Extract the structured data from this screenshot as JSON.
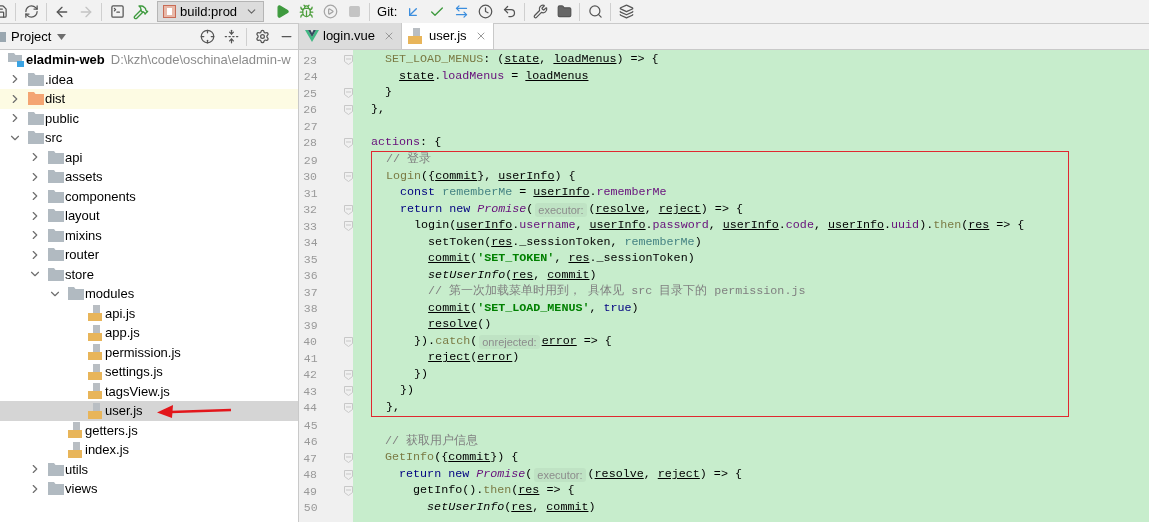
{
  "toolbar": {
    "run_configuration": "build:prod",
    "vcs_label": "Git:"
  },
  "project_panel": {
    "title": "Project",
    "tree": {
      "name": "eladmin-web",
      "path": "D:\\kzh\\code\\oschina\\eladmin-w",
      "kind": "project",
      "selected": false,
      "children": [
        {
          "name": ".idea",
          "kind": "folder",
          "expanded": false,
          "selected": false
        },
        {
          "name": "dist",
          "kind": "excluded_folder",
          "expanded": false,
          "selected": false
        },
        {
          "name": "public",
          "kind": "folder",
          "expanded": false,
          "selected": false
        },
        {
          "name": "src",
          "kind": "folder",
          "expanded": true,
          "selected": false,
          "children": [
            {
              "name": "api",
              "kind": "folder",
              "expanded": false,
              "selected": false
            },
            {
              "name": "assets",
              "kind": "folder",
              "expanded": false,
              "selected": false
            },
            {
              "name": "components",
              "kind": "folder",
              "expanded": false,
              "selected": false
            },
            {
              "name": "layout",
              "kind": "folder",
              "expanded": false,
              "selected": false
            },
            {
              "name": "mixins",
              "kind": "folder",
              "expanded": false,
              "selected": false
            },
            {
              "name": "router",
              "kind": "folder",
              "expanded": false,
              "selected": false
            },
            {
              "name": "store",
              "kind": "folder",
              "expanded": true,
              "selected": false,
              "children": [
                {
                  "name": "modules",
                  "kind": "folder",
                  "expanded": true,
                  "selected": false,
                  "children": [
                    {
                      "name": "api.js",
                      "kind": "file",
                      "selected": false
                    },
                    {
                      "name": "app.js",
                      "kind": "file",
                      "selected": false
                    },
                    {
                      "name": "permission.js",
                      "kind": "file",
                      "selected": false
                    },
                    {
                      "name": "settings.js",
                      "kind": "file",
                      "selected": false
                    },
                    {
                      "name": "tagsView.js",
                      "kind": "file",
                      "selected": false
                    },
                    {
                      "name": "user.js",
                      "kind": "file",
                      "selected": true
                    }
                  ]
                },
                {
                  "name": "getters.js",
                  "kind": "file",
                  "selected": false
                },
                {
                  "name": "index.js",
                  "kind": "file",
                  "selected": false
                }
              ]
            },
            {
              "name": "utils",
              "kind": "folder",
              "expanded": false,
              "selected": false
            },
            {
              "name": "views",
              "kind": "folder",
              "expanded": false,
              "selected": false
            }
          ]
        }
      ]
    }
  },
  "editor": {
    "tabs": [
      {
        "label": "login.vue",
        "kind": "vue",
        "selected": false
      },
      {
        "label": "user.js",
        "kind": "js",
        "selected": true
      }
    ],
    "code_blocks": [
      {
        "kind": "plain",
        "lines": [
          {
            "number": "23",
            "fold": true,
            "tokens": [
              {
                "kind": "method",
                "text": "  SET_LOAD_MENUS"
              },
              {
                "kind": "plain",
                "text": ": ("
              },
              {
                "kind": "ref",
                "text": "state"
              },
              {
                "kind": "plain",
                "text": ", "
              },
              {
                "kind": "ref",
                "text": "loadMenus"
              },
              {
                "kind": "plain",
                "text": ") => {"
              }
            ]
          },
          {
            "number": "24",
            "fold": false,
            "tokens": [
              {
                "kind": "ref",
                "text": "    state"
              },
              {
                "kind": "plain",
                "text": "."
              },
              {
                "kind": "field",
                "text": "loadMenus"
              },
              {
                "kind": "plain",
                "text": " = "
              },
              {
                "kind": "ref",
                "text": "loadMenus"
              }
            ]
          },
          {
            "number": "25",
            "fold": true,
            "tokens": [
              {
                "kind": "plain",
                "text": "  }"
              }
            ]
          },
          {
            "number": "26",
            "fold": true,
            "tokens": [
              {
                "kind": "plain",
                "text": "},"
              }
            ]
          },
          {
            "number": "27",
            "fold": false
          },
          {
            "number": "28",
            "fold": true,
            "tokens": [
              {
                "kind": "field",
                "text": "actions"
              },
              {
                "kind": "plain",
                "text": ": {"
              }
            ]
          }
        ]
      },
      {
        "kind": "boxed",
        "lines": [
          {
            "number": "29",
            "fold": false,
            "tokens": [
              {
                "kind": "comment",
                "text": "  // 登录"
              }
            ]
          },
          {
            "number": "30",
            "fold": true,
            "tokens": [
              {
                "kind": "method",
                "text": "  Login"
              },
              {
                "kind": "plain",
                "text": "({"
              },
              {
                "kind": "ref",
                "text": "commit"
              },
              {
                "kind": "plain",
                "text": "}, "
              },
              {
                "kind": "ref",
                "text": "userInfo"
              },
              {
                "kind": "plain",
                "text": ") {"
              }
            ]
          },
          {
            "number": "31",
            "fold": false,
            "tokens": [
              {
                "kind": "keyword",
                "text": "    const "
              },
              {
                "kind": "local",
                "text": "rememberMe"
              },
              {
                "kind": "plain",
                "text": " = "
              },
              {
                "kind": "ref",
                "text": "userInfo"
              },
              {
                "kind": "plain",
                "text": "."
              },
              {
                "kind": "field",
                "text": "rememberMe"
              }
            ]
          },
          {
            "number": "32",
            "fold": true,
            "tokens": [
              {
                "kind": "keyword",
                "text": "    return new "
              },
              {
                "kind": "class",
                "text": "Promise"
              },
              {
                "kind": "plain",
                "text": "("
              },
              {
                "kind": "hint",
                "text": "executor:"
              },
              {
                "kind": "plain",
                "text": "("
              },
              {
                "kind": "ref",
                "text": "resolve"
              },
              {
                "kind": "plain",
                "text": ", "
              },
              {
                "kind": "ref",
                "text": "reject"
              },
              {
                "kind": "plain",
                "text": ") => {"
              }
            ]
          },
          {
            "number": "33",
            "fold": true,
            "tokens": [
              {
                "kind": "plain",
                "text": "      login("
              },
              {
                "kind": "ref",
                "text": "userInfo"
              },
              {
                "kind": "plain",
                "text": "."
              },
              {
                "kind": "field",
                "text": "username"
              },
              {
                "kind": "plain",
                "text": ", "
              },
              {
                "kind": "ref",
                "text": "userInfo"
              },
              {
                "kind": "plain",
                "text": "."
              },
              {
                "kind": "field",
                "text": "password"
              },
              {
                "kind": "plain",
                "text": ", "
              },
              {
                "kind": "ref",
                "text": "userInfo"
              },
              {
                "kind": "plain",
                "text": "."
              },
              {
                "kind": "field",
                "text": "code"
              },
              {
                "kind": "plain",
                "text": ", "
              },
              {
                "kind": "ref",
                "text": "userInfo"
              },
              {
                "kind": "plain",
                "text": "."
              },
              {
                "kind": "field",
                "text": "uuid"
              },
              {
                "kind": "plain",
                "text": ")."
              },
              {
                "kind": "method",
                "text": "then"
              },
              {
                "kind": "plain",
                "text": "("
              },
              {
                "kind": "ref",
                "text": "res"
              },
              {
                "kind": "plain",
                "text": " => {"
              }
            ]
          },
          {
            "number": "34",
            "fold": false,
            "tokens": [
              {
                "kind": "plain",
                "text": "        setToken("
              },
              {
                "kind": "ref",
                "text": "res"
              },
              {
                "kind": "plain",
                "text": "._sessionToken, "
              },
              {
                "kind": "local",
                "text": "rememberMe"
              },
              {
                "kind": "plain",
                "text": ")"
              }
            ]
          },
          {
            "number": "35",
            "fold": false,
            "tokens": [
              {
                "kind": "ref",
                "text": "        commit"
              },
              {
                "kind": "plain",
                "text": "("
              },
              {
                "kind": "string",
                "text": "'SET_TOKEN'"
              },
              {
                "kind": "plain",
                "text": ", "
              },
              {
                "kind": "ref",
                "text": "res"
              },
              {
                "kind": "plain",
                "text": "._sessionToken)"
              }
            ]
          },
          {
            "number": "36",
            "fold": false,
            "tokens": [
              {
                "kind": "italic",
                "text": "        setUserInfo"
              },
              {
                "kind": "plain",
                "text": "("
              },
              {
                "kind": "ref",
                "text": "res"
              },
              {
                "kind": "plain",
                "text": ", "
              },
              {
                "kind": "ref",
                "text": "commit"
              },
              {
                "kind": "plain",
                "text": ")"
              }
            ]
          },
          {
            "number": "37",
            "fold": false,
            "tokens": [
              {
                "kind": "comment",
                "text": "        // 第一次加载菜单时用到， 具体见 src 目录下的 permission.js"
              }
            ]
          },
          {
            "number": "38",
            "fold": false,
            "tokens": [
              {
                "kind": "ref",
                "text": "        commit"
              },
              {
                "kind": "plain",
                "text": "("
              },
              {
                "kind": "string",
                "text": "'SET_LOAD_MENUS'"
              },
              {
                "kind": "plain",
                "text": ", "
              },
              {
                "kind": "keyword",
                "text": "true"
              },
              {
                "kind": "plain",
                "text": ")"
              }
            ]
          },
          {
            "number": "39",
            "fold": false,
            "tokens": [
              {
                "kind": "ref",
                "text": "        resolve"
              },
              {
                "kind": "plain",
                "text": "()"
              }
            ]
          },
          {
            "number": "40",
            "fold": true,
            "tokens": [
              {
                "kind": "plain",
                "text": "      })."
              },
              {
                "kind": "method",
                "text": "catch"
              },
              {
                "kind": "plain",
                "text": "("
              },
              {
                "kind": "hint",
                "text": "onrejected:"
              },
              {
                "kind": "ref",
                "text": "error"
              },
              {
                "kind": "plain",
                "text": " => {"
              }
            ]
          },
          {
            "number": "41",
            "fold": false,
            "tokens": [
              {
                "kind": "ref",
                "text": "        reject"
              },
              {
                "kind": "plain",
                "text": "("
              },
              {
                "kind": "ref",
                "text": "error"
              },
              {
                "kind": "plain",
                "text": ")"
              }
            ]
          },
          {
            "number": "42",
            "fold": true,
            "tokens": [
              {
                "kind": "plain",
                "text": "      })"
              }
            ]
          },
          {
            "number": "43",
            "fold": true,
            "tokens": [
              {
                "kind": "plain",
                "text": "    })"
              }
            ]
          },
          {
            "number": "44",
            "fold": true,
            "tokens": [
              {
                "kind": "plain",
                "text": "  },"
              }
            ]
          }
        ]
      },
      {
        "kind": "plain",
        "lines": [
          {
            "number": "45",
            "fold": false
          },
          {
            "number": "46",
            "fold": false,
            "tokens": [
              {
                "kind": "comment",
                "text": "  // 获取用户信息"
              }
            ]
          },
          {
            "number": "47",
            "fold": true,
            "tokens": [
              {
                "kind": "method",
                "text": "  GetInfo"
              },
              {
                "kind": "plain",
                "text": "({"
              },
              {
                "kind": "ref",
                "text": "commit"
              },
              {
                "kind": "plain",
                "text": "}) {"
              }
            ]
          },
          {
            "number": "48",
            "fold": true,
            "tokens": [
              {
                "kind": "keyword",
                "text": "    return new "
              },
              {
                "kind": "class",
                "text": "Promise"
              },
              {
                "kind": "plain",
                "text": "("
              },
              {
                "kind": "hint",
                "text": "executor:"
              },
              {
                "kind": "plain",
                "text": "("
              },
              {
                "kind": "ref",
                "text": "resolve"
              },
              {
                "kind": "plain",
                "text": ", "
              },
              {
                "kind": "ref",
                "text": "reject"
              },
              {
                "kind": "plain",
                "text": ") => {"
              }
            ]
          },
          {
            "number": "49",
            "fold": true,
            "tokens": [
              {
                "kind": "plain",
                "text": "      getInfo()."
              },
              {
                "kind": "method",
                "text": "then"
              },
              {
                "kind": "plain",
                "text": "("
              },
              {
                "kind": "ref",
                "text": "res"
              },
              {
                "kind": "plain",
                "text": " => {"
              }
            ]
          },
          {
            "number": "50",
            "fold": false,
            "tokens": [
              {
                "kind": "italic",
                "text": "        setUserInfo"
              },
              {
                "kind": "plain",
                "text": "("
              },
              {
                "kind": "ref",
                "text": "res"
              },
              {
                "kind": "plain",
                "text": ", "
              },
              {
                "kind": "ref",
                "text": "commit"
              },
              {
                "kind": "plain",
                "text": ")"
              }
            ]
          }
        ]
      }
    ]
  }
}
